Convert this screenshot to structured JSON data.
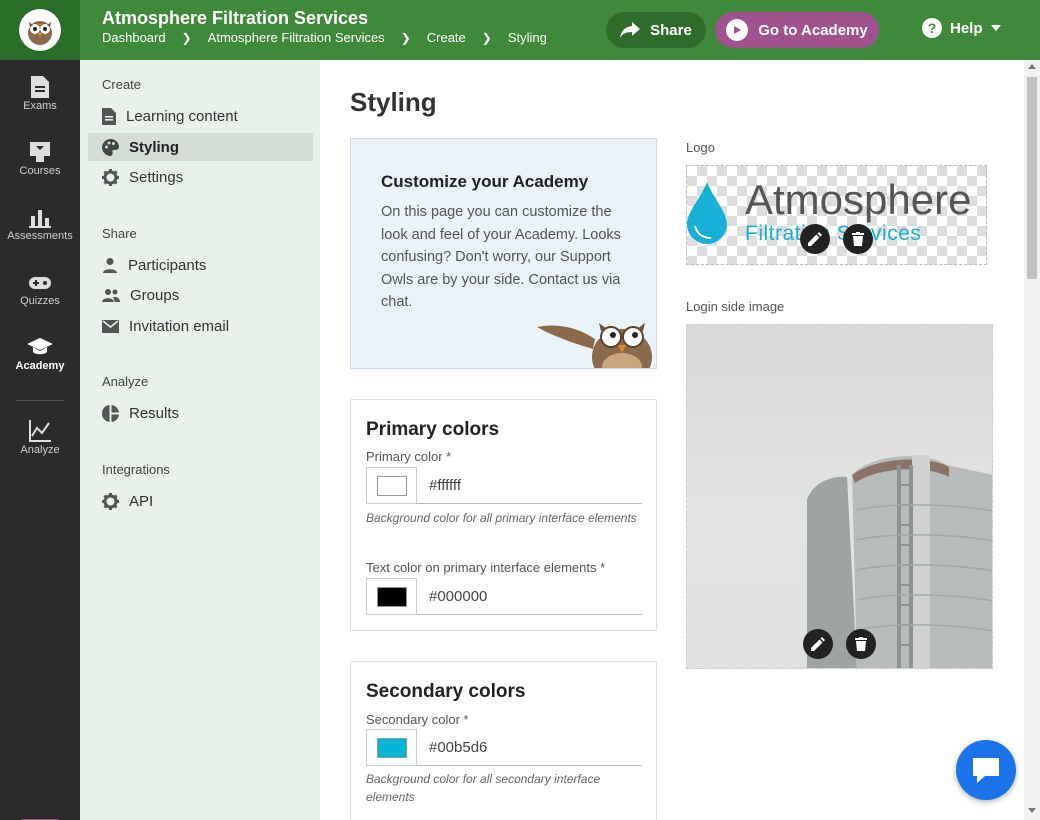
{
  "header": {
    "app_title": "Atmosphere Filtration Services",
    "breadcrumb": [
      "Dashboard",
      "Atmosphere Filtration Services",
      "Create",
      "Styling"
    ],
    "share_label": "Share",
    "academy_label": "Go to Academy",
    "help_label": "Help"
  },
  "rail": {
    "items": [
      {
        "label": "Exams",
        "icon": "document-icon"
      },
      {
        "label": "Courses",
        "icon": "courses-icon"
      },
      {
        "label": "Assessments",
        "icon": "bar-chart-icon"
      },
      {
        "label": "Quizzes",
        "icon": "gamepad-icon"
      },
      {
        "label": "Academy",
        "icon": "graduation-cap-icon"
      },
      {
        "label": "Analyze",
        "icon": "line-chart-icon"
      }
    ],
    "active": "Academy"
  },
  "sidebar": {
    "sections": [
      {
        "heading": "Create",
        "items": [
          {
            "label": "Learning content",
            "icon": "document-icon"
          },
          {
            "label": "Styling",
            "icon": "palette-icon"
          },
          {
            "label": "Settings",
            "icon": "gear-icon"
          }
        ]
      },
      {
        "heading": "Share",
        "items": [
          {
            "label": "Participants",
            "icon": "person-icon"
          },
          {
            "label": "Groups",
            "icon": "group-icon"
          },
          {
            "label": "Invitation email",
            "icon": "mail-icon"
          }
        ]
      },
      {
        "heading": "Analyze",
        "items": [
          {
            "label": "Results",
            "icon": "pie-chart-icon"
          }
        ]
      },
      {
        "heading": "Integrations",
        "items": [
          {
            "label": "API",
            "icon": "gear-icon"
          }
        ]
      }
    ],
    "active": "Styling"
  },
  "main": {
    "page_title": "Styling",
    "info_card": {
      "title": "Customize your Academy",
      "body": "On this page you can customize the look and feel of your Academy. Looks confusing? Don't worry, our Support Owls are by your side. Contact us via chat."
    },
    "primary_colors": {
      "title": "Primary colors",
      "primary_label": "Primary color *",
      "primary_value": "#ffffff",
      "primary_hint": "Background color for all primary interface elements",
      "text_label": "Text color on primary interface elements *",
      "text_value": "#000000"
    },
    "secondary_colors": {
      "title": "Secondary colors",
      "secondary_label": "Secondary color *",
      "secondary_value": "#00b5d6",
      "secondary_hint": "Background color for all secondary interface elements"
    },
    "logo": {
      "label": "Logo",
      "word": "Atmosphere",
      "sub": "Filtration Services"
    },
    "login_image": {
      "label": "Login side image"
    }
  },
  "colors": {
    "header_green": "#3f8a3a",
    "academy_purple": "#a0528e",
    "secondary_blue": "#00b5d6",
    "chat_blue": "#1a73e8"
  }
}
